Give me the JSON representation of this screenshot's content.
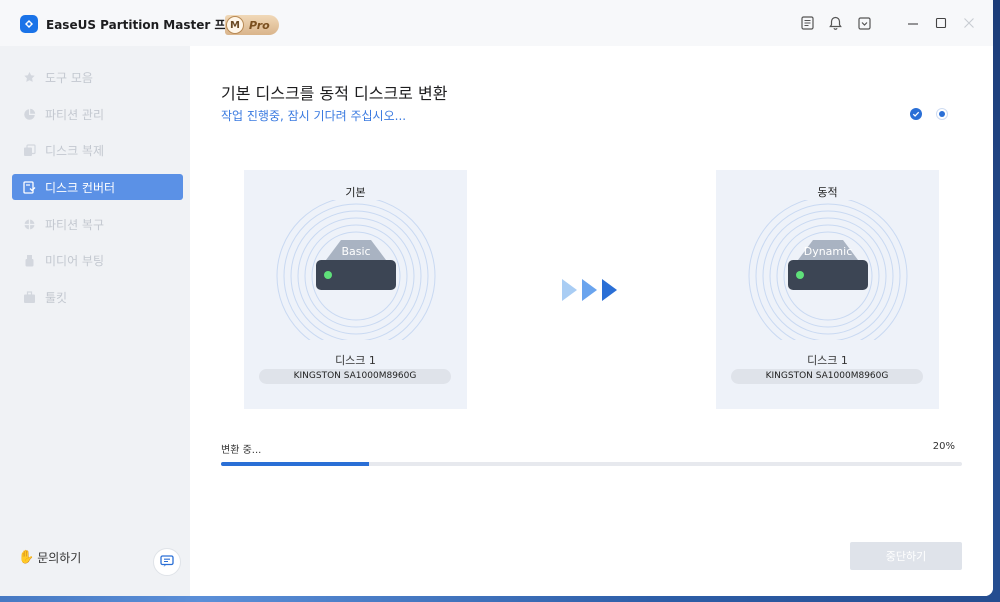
{
  "app": {
    "title": "EaseUS Partition Master 프로 버전",
    "badge_letter": "M",
    "badge_label": "Pro"
  },
  "sidebar": {
    "items": [
      {
        "label": "도구 모음",
        "icon": "toolbox-icon",
        "active": false
      },
      {
        "label": "파티션 관리",
        "icon": "pie-chart-icon",
        "active": false
      },
      {
        "label": "디스크 복제",
        "icon": "copy-icon",
        "active": false
      },
      {
        "label": "디스크 컨버터",
        "icon": "disk-convert-icon",
        "active": true
      },
      {
        "label": "파티션 복구",
        "icon": "recovery-icon",
        "active": false
      },
      {
        "label": "미디어 부팅",
        "icon": "usb-icon",
        "active": false
      },
      {
        "label": "툴킷",
        "icon": "toolkit-icon",
        "active": false
      }
    ],
    "help_label": "문의하기"
  },
  "main": {
    "title": "기본 디스크를 동적 디스크로 변환",
    "subtitle": "작업 진행중, 잠시 기다려 주십시오...",
    "source": {
      "header": "기본",
      "disk_label": "Basic",
      "disk_name": "디스크 1",
      "model": "KINGSTON SA1000M8960G"
    },
    "target": {
      "header": "동적",
      "disk_label": "Dynamic",
      "disk_name": "디스크 1",
      "model": "KINGSTON SA1000M8960G"
    },
    "progress": {
      "label": "변환 중...",
      "percent_text": "20%",
      "value": 0.2
    },
    "stop_button": "중단하기"
  },
  "colors": {
    "accent": "#2a6fd6",
    "active_nav": "#5b91e6"
  }
}
